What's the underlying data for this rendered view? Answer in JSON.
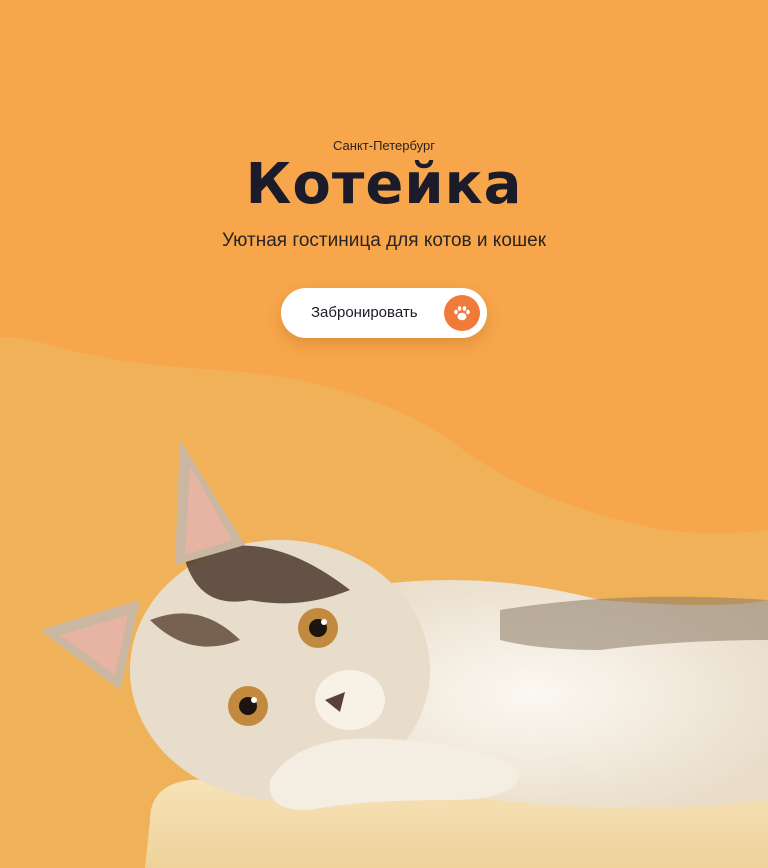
{
  "hero": {
    "city": "Санкт-Петербург",
    "title": "Котейка",
    "subtitle": "Уютная гостиница для котов и кошек",
    "cta_label": "Забронировать",
    "cta_icon": "paw-icon",
    "photo_subject": "kitten-photo"
  },
  "colors": {
    "background": "#f6a848",
    "title": "#1c1b2a",
    "accent": "#f07a3a",
    "button_bg": "#ffffff"
  }
}
